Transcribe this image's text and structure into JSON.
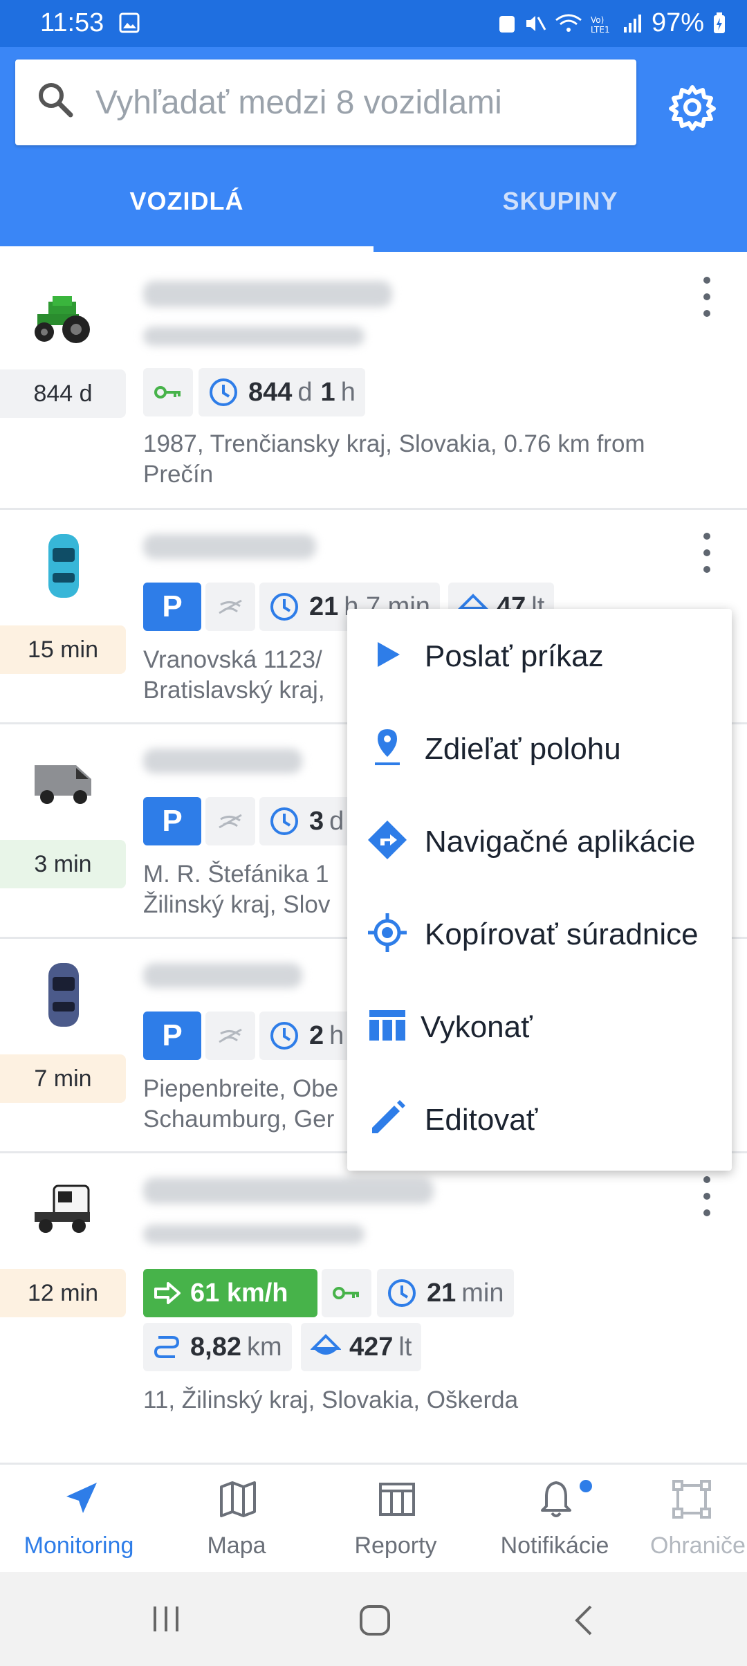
{
  "status": {
    "time": "11:53",
    "battery": "97%"
  },
  "search": {
    "placeholder": "Vyhľadať medzi 8 vozidlami"
  },
  "tabs": [
    {
      "label": "VOZIDLÁ"
    },
    {
      "label": "SKUPINY"
    }
  ],
  "vehicles": [
    {
      "icon": "tractor-icon",
      "badge": "844 d",
      "chips": {
        "time_value": "844",
        "time_unit": "d",
        "time_value2": "1",
        "time_unit2": "h"
      },
      "address": "1987, Trenčiansky kraj, Slovakia, 0.76 km from Prečín"
    },
    {
      "icon": "car-icon",
      "badge": "15 min",
      "chips": {
        "park": "P",
        "time": "21",
        "time_unit": "h 7 min",
        "fuel": "47",
        "fuel_unit": "lt"
      },
      "address_lines": [
        "Vranovská 1123/",
        "Bratislavský kraj,"
      ]
    },
    {
      "icon": "van-icon",
      "badge": "3 min",
      "chips": {
        "park": "P",
        "time": "3",
        "time_unit": "d"
      },
      "address_lines": [
        "M. R. Štefánika 1",
        "Žilinský kraj, Slov"
      ]
    },
    {
      "icon": "car-icon",
      "badge": "7 min",
      "chips": {
        "park": "P",
        "time": "2",
        "time_unit": "h"
      },
      "address_lines": [
        "Piepenbreite, Obe",
        "Schaumburg, Ger"
      ]
    },
    {
      "icon": "truck-icon",
      "badge": "12 min",
      "chips": {
        "speed": "61 km/h",
        "time": "21",
        "time_unit": "min",
        "distance": "8,82",
        "distance_unit": "km",
        "fuel": "427",
        "fuel_unit": "lt"
      },
      "address": "11, Žilinský kraj, Slovakia, Oškerda"
    }
  ],
  "menu": [
    {
      "label": "Poslať príkaz",
      "icon": "send-icon"
    },
    {
      "label": "Zdieľať polohu",
      "icon": "location-pin-icon"
    },
    {
      "label": "Navigačné aplikácie",
      "icon": "directions-icon"
    },
    {
      "label": "Kopírovať súradnice",
      "icon": "crosshair-icon"
    },
    {
      "label": "Vykonať",
      "icon": "columns-icon"
    },
    {
      "label": "Editovať",
      "icon": "pencil-icon"
    }
  ],
  "nav": [
    {
      "label": "Monitoring",
      "icon": "navigation-arrow-icon"
    },
    {
      "label": "Mapa",
      "icon": "map-icon"
    },
    {
      "label": "Reporty",
      "icon": "reports-icon"
    },
    {
      "label": "Notifikácie",
      "icon": "bell-icon"
    },
    {
      "label": "Ohraničenia",
      "icon": "geofence-icon"
    }
  ],
  "colors": {
    "primary": "#3a86f6",
    "statusbar": "#1f6fe0",
    "accent": "#2e7de8",
    "green": "#47b34a"
  }
}
